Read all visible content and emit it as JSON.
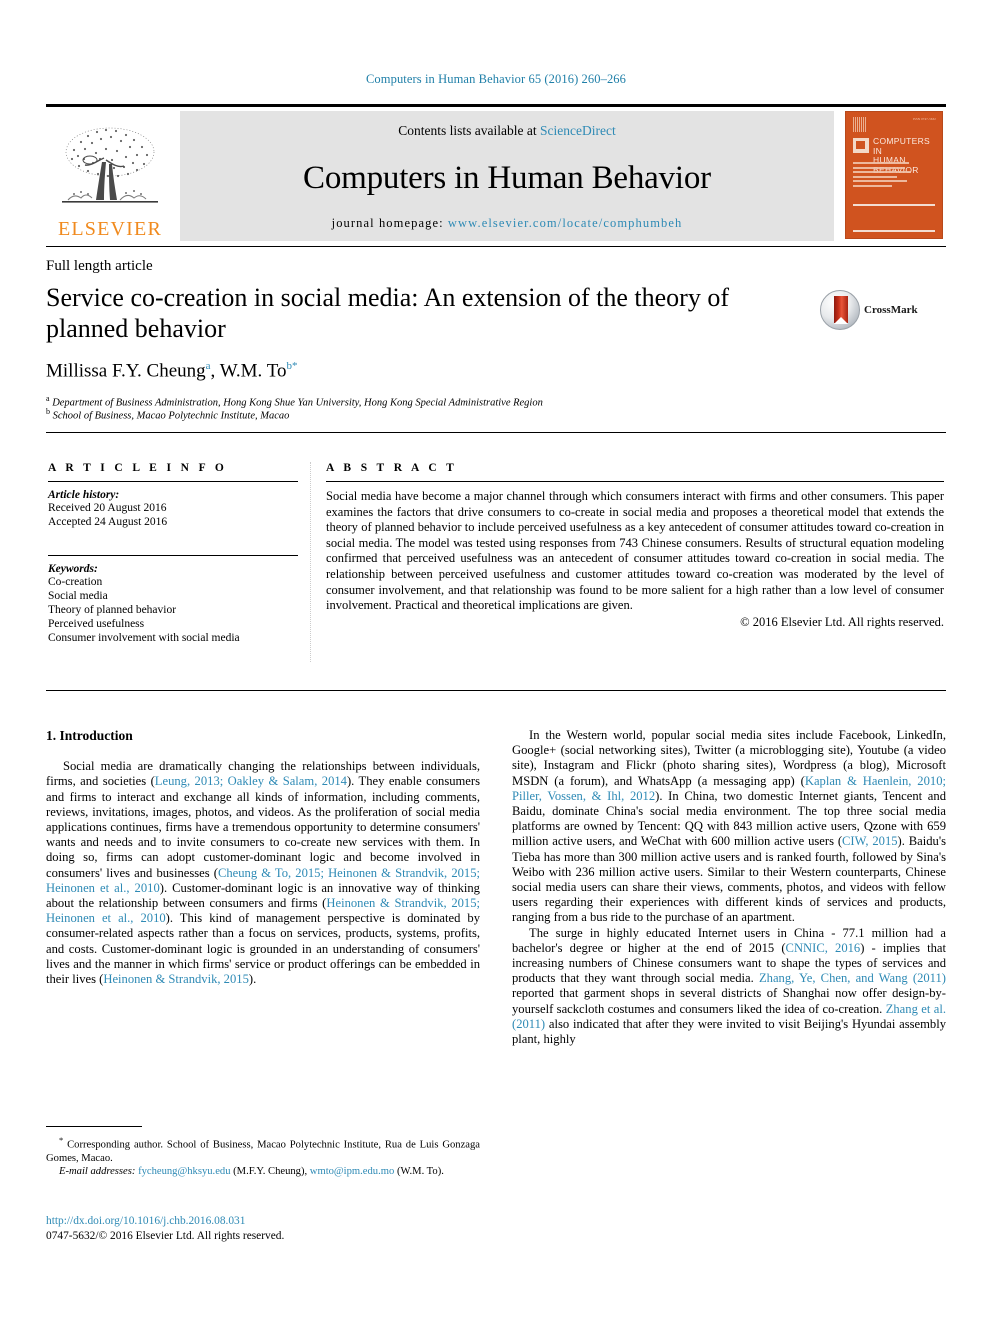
{
  "running_head": "Computers in Human Behavior 65 (2016) 260–266",
  "masthead": {
    "publisher_name": "ELSEVIER",
    "contents_prefix": "Contents lists available at ",
    "contents_link": "ScienceDirect",
    "journal_title": "Computers in Human Behavior",
    "homepage_prefix": "journal homepage: ",
    "homepage_url": "www.elsevier.com/locate/comphumbeh",
    "cover": {
      "title_line1": "COMPUTERS IN",
      "title_line2": "HUMAN BEHAVIOR",
      "corner_note": "ISSN 0747-5632"
    }
  },
  "article": {
    "type": "Full length article",
    "title": "Service co-creation in social media: An extension of the theory of planned behavior",
    "crossmark_label": "CrossMark",
    "authors_line": {
      "author1": "Millissa F.Y. Cheung",
      "author1_mark": "a",
      "separator": ", ",
      "author2": "W.M. To",
      "author2_mark": "b",
      "author2_star": "*"
    },
    "affiliations": [
      {
        "mark": "a",
        "text": "Department of Business Administration, Hong Kong Shue Yan University, Hong Kong Special Administrative Region"
      },
      {
        "mark": "b",
        "text": "School of Business, Macao Polytechnic Institute, Macao"
      }
    ]
  },
  "article_info": {
    "heading": "A R T I C L E  I N F O",
    "history_label": "Article history:",
    "history": [
      "Received 20 August 2016",
      "Accepted 24 August 2016"
    ],
    "keywords_label": "Keywords:",
    "keywords": [
      "Co-creation",
      "Social media",
      "Theory of planned behavior",
      "Perceived usefulness",
      "Consumer involvement with social media"
    ]
  },
  "abstract": {
    "heading": "A B S T R A C T",
    "text": "Social media have become a major channel through which consumers interact with firms and other consumers. This paper examines the factors that drive consumers to co-create in social media and proposes a theoretical model that extends the theory of planned behavior to include perceived usefulness as a key antecedent of consumer attitudes toward co-creation in social media. The model was tested using responses from 743 Chinese consumers. Results of structural equation modeling confirmed that perceived usefulness was an antecedent of consumer attitudes toward co-creation in social media. The relationship between perceived usefulness and customer attitudes toward co-creation was moderated by the level of consumer involvement, and that relationship was found to be more salient for a high rather than a low level of consumer involvement. Practical and theoretical implications are given.",
    "copyright": "© 2016 Elsevier Ltd. All rights reserved."
  },
  "body": {
    "section1_heading": "1. Introduction",
    "left_paragraphs": [
      {
        "parts": [
          {
            "t": "Social media are dramatically changing the relationships between individuals, firms, and societies (",
            "k": "n"
          },
          {
            "t": "Leung, 2013; Oakley & Salam, 2014",
            "k": "r"
          },
          {
            "t": "). They enable consumers and firms to interact and exchange all kinds of information, including comments, reviews, invitations, images, photos, and videos. As the proliferation of social media applications continues, firms have a tremendous opportunity to determine consumers' wants and needs and to invite consumers to co-create new services with them. In doing so, firms can adopt customer-dominant logic and become involved in consumers' lives and businesses (",
            "k": "n"
          },
          {
            "t": "Cheung & To, 2015; Heinonen & Strandvik, 2015; Heinonen et al., 2010",
            "k": "r"
          },
          {
            "t": "). Customer-dominant logic is an innovative way of thinking about the relationship between consumers and firms (",
            "k": "n"
          },
          {
            "t": "Heinonen & Strandvik, 2015; Heinonen et al., 2010",
            "k": "r"
          },
          {
            "t": "). This kind of management perspective is dominated by consumer-related aspects rather than a focus on services, products, systems, profits, and costs. Customer-dominant logic is grounded in an understanding of consumers' lives and the manner in which firms' service or product offerings can be embedded in their lives (",
            "k": "n"
          },
          {
            "t": "Heinonen & Strandvik, 2015",
            "k": "r"
          },
          {
            "t": ").",
            "k": "n"
          }
        ]
      }
    ],
    "right_paragraphs": [
      {
        "parts": [
          {
            "t": "In the Western world, popular social media sites include Facebook, LinkedIn, Google+ (social networking sites), Twitter (a microblogging site), Youtube (a video site), Instagram and Flickr (photo sharing sites), Wordpress (a blog), Microsoft MSDN (a forum), and WhatsApp (a messaging app) (",
            "k": "n"
          },
          {
            "t": "Kaplan & Haenlein, 2010; Piller, Vossen, & Ihl, 2012",
            "k": "r"
          },
          {
            "t": "). In China, two domestic Internet giants, Tencent and Baidu, dominate China's social media environment. The top three social media platforms are owned by Tencent: QQ with 843 million active users, Qzone with 659 million active users, and WeChat with 600 million active users (",
            "k": "n"
          },
          {
            "t": "CIW, 2015",
            "k": "r"
          },
          {
            "t": "). Baidu's Tieba has more than 300 million active users and is ranked fourth, followed by Sina's Weibo with 236 million active users. Similar to their Western counterparts, Chinese social media users can share their views, comments, photos, and videos with fellow users regarding their experiences with different kinds of services and products, ranging from a bus ride to the purchase of an apartment.",
            "k": "n"
          }
        ]
      },
      {
        "parts": [
          {
            "t": "The surge in highly educated Internet users in China - 77.1 million had a bachelor's degree or higher at the end of 2015 (",
            "k": "n"
          },
          {
            "t": "CNNIC, 2016",
            "k": "r"
          },
          {
            "t": ") - implies that increasing numbers of Chinese consumers want to shape the types of services and products that they want through social media. ",
            "k": "n"
          },
          {
            "t": "Zhang, Ye, Chen, and Wang (2011)",
            "k": "r"
          },
          {
            "t": " reported that garment shops in several districts of Shanghai now offer design-by-yourself sackcloth costumes and consumers liked the idea of co-creation. ",
            "k": "n"
          },
          {
            "t": "Zhang et al. (2011)",
            "k": "r"
          },
          {
            "t": " also indicated that after they were invited to visit Beijing's Hyundai assembly plant, highly",
            "k": "n"
          }
        ]
      }
    ]
  },
  "footnote": {
    "star": "*",
    "corresponding": " Corresponding author. School of Business, Macao Polytechnic Institute, Rua de Luis Gonzaga Gomes, Macao.",
    "email_label": "E-mail addresses:",
    "email1": "fycheung@hksyu.edu",
    "email1_owner": " (M.F.Y. Cheung), ",
    "email2": "wmto@ipm.edu.mo",
    "email2_owner": " (W.M. To)."
  },
  "doi_block": {
    "doi": "http://dx.doi.org/10.1016/j.chb.2016.08.031",
    "issn_line": "0747-5632/© 2016 Elsevier Ltd. All rights reserved."
  },
  "colors": {
    "link": "#2e8ab5",
    "elsevier_orange": "#f08a1e",
    "cover_orange": "#d0531f",
    "masthead_gray": "#e3e3e3"
  }
}
